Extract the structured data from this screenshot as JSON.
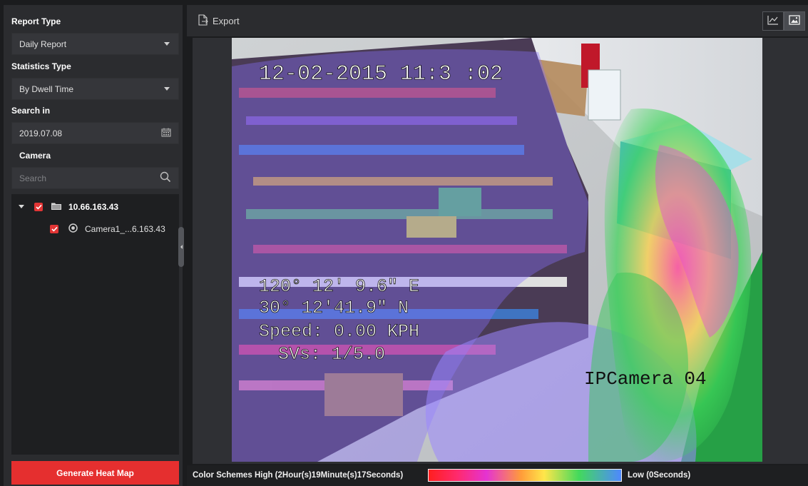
{
  "left_panel": {
    "report_type_label": "Report Type",
    "report_type_value": "Daily Report",
    "statistics_type_label": "Statistics Type",
    "statistics_type_value": "By Dwell Time",
    "search_in_label": "Search in",
    "date_value": "2019.07.08",
    "camera_label": "Camera",
    "search_placeholder": "Search",
    "tree": {
      "root_label": "10.66.163.43",
      "child_label": "Camera1_...6.163.43"
    },
    "generate_button_label": "Generate Heat Map"
  },
  "toolbar": {
    "export_label": "Export",
    "view_modes": [
      "chart-view-icon",
      "image-view-icon"
    ],
    "active_view": "image"
  },
  "overlay": {
    "timestamp": "12-02-2015 11:3 :02",
    "longitude": "120° 12' 9.6\" E",
    "latitude": "30° 12'41.9\" N",
    "speed": "Speed: 0.00 KPH",
    "svs": "SVs: 1/5.0",
    "camera_name": "IPCamera 04"
  },
  "footer": {
    "color_schemes_label": "Color Schemes",
    "high_label": "High (2Hour(s)19Minute(s)17Seconds)",
    "low_label": "Low (0Seconds)"
  },
  "colors": {
    "accent_red": "#e52f2f",
    "panel_bg": "#2b2c2f",
    "dark_bg": "#1e1f21"
  }
}
